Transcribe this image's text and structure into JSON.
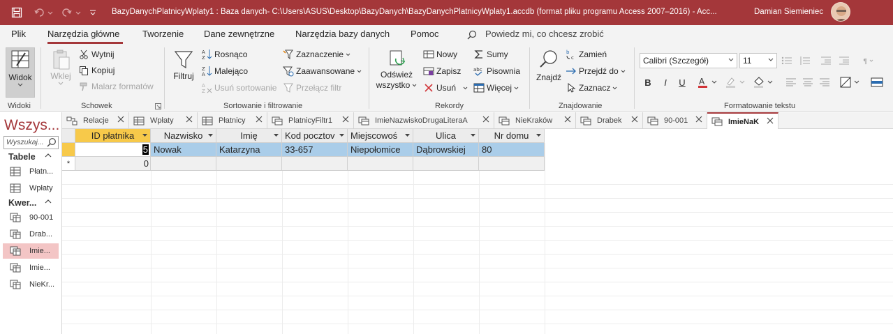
{
  "titlebar": {
    "title": "BazyDanychPlatnicyWplaty1 : Baza danych- C:\\Users\\ASUS\\Desktop\\BazyDanych\\BazyDanychPlatnicyWplaty1.accdb (format pliku programu Access 2007–2016)  -  Acc...",
    "user": "Damian Siemieniec"
  },
  "menu": {
    "items": [
      "Plik",
      "Narzędzia główne",
      "Tworzenie",
      "Dane zewnętrzne",
      "Narzędzia bazy danych",
      "Pomoc"
    ],
    "tellme": "Powiedz mi, co chcesz zrobić"
  },
  "ribbon": {
    "widoki": {
      "button": "Widok",
      "label": "Widoki"
    },
    "schowek": {
      "wklej": "Wklej",
      "wytnij": "Wytnij",
      "kopiuj": "Kopiuj",
      "malarz": "Malarz formatów",
      "label": "Schowek"
    },
    "sort": {
      "filtruj": "Filtruj",
      "rosnaco": "Rosnąco",
      "malejaco": "Malejąco",
      "usun_sort": "Usuń sortowanie",
      "zaznaczenie": "Zaznaczenie",
      "zaawansowane": "Zaawansowane",
      "przelacz": "Przełącz filtr",
      "label": "Sortowanie i filtrowanie"
    },
    "rekordy": {
      "odswiez_1": "Odśwież",
      "odswiez_2": "wszystko",
      "nowy": "Nowy",
      "zapisz": "Zapisz",
      "usun": "Usuń",
      "sumy": "Sumy",
      "pisownia": "Pisownia",
      "wiecej": "Więcej",
      "label": "Rekordy"
    },
    "znajdowanie": {
      "znajdz": "Znajdź",
      "zamien": "Zamień",
      "przejdz": "Przejdź do",
      "zaznacz": "Zaznacz",
      "label": "Znajdowanie"
    },
    "format": {
      "font": "Calibri (Szczegół)",
      "size": "11",
      "bold": "B",
      "italic": "I",
      "underline": "U",
      "label": "Formatowanie tekstu"
    }
  },
  "nav": {
    "title": "Wszys...",
    "search_placeholder": "Wyszukaj...",
    "sections": [
      {
        "name": "Tabele",
        "items": [
          "Płatn...",
          "Wpłaty"
        ]
      },
      {
        "name": "Kwer...",
        "items": [
          "90-001",
          "Drab...",
          "Imie...",
          "Imie...",
          "NieKr..."
        ]
      }
    ]
  },
  "doctabs": [
    "Relacje",
    "Wpłaty",
    "Płatnicy",
    "PlatnicyFiltr1",
    "ImieNazwiskoDrugaLiteraA",
    "NieKraków",
    "Drabek",
    "90-001",
    "ImieNaK"
  ],
  "grid": {
    "columns": [
      "ID płatnika",
      "Nazwisko",
      "Imię",
      "Kod pocztov",
      "Miejscowoś",
      "Ulica",
      "Nr domu"
    ],
    "rows": [
      [
        "5",
        "Nowak",
        "Katarzyna",
        "33-657",
        "Niepołomice",
        "Dąbrowskiej",
        "80"
      ]
    ],
    "new_row": {
      "marker": "*",
      "id_default": "0"
    }
  },
  "colors": {
    "accent": "#a4373a",
    "selected_row": "#aacde9",
    "header_sorted": "#f7c94a",
    "nav_selected": "#f3c5c5"
  }
}
